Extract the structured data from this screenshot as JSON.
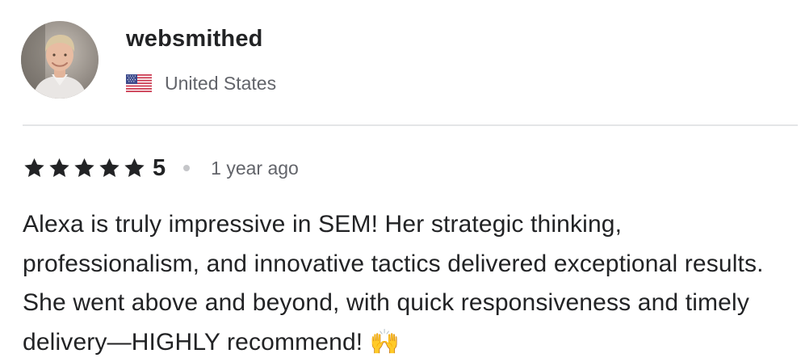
{
  "reviewer": {
    "username": "websmithed",
    "country": "United States",
    "avatar_icon": "profile-photo",
    "flag_icon": "us-flag-icon"
  },
  "rating": {
    "value": "5",
    "stars": 5,
    "max_stars": 5,
    "time": "1 year ago"
  },
  "review": {
    "text": "Alexa is truly impressive in SEM! Her strategic thinking, professionalism, and innovative tactics delivered exceptional results. She went above and beyond, with quick responsiveness and timely delivery—HIGHLY recommend! 🙌"
  },
  "colors": {
    "text_primary": "#222325",
    "text_secondary": "#62646a",
    "divider": "#e4e5e7",
    "star": "#222325"
  }
}
